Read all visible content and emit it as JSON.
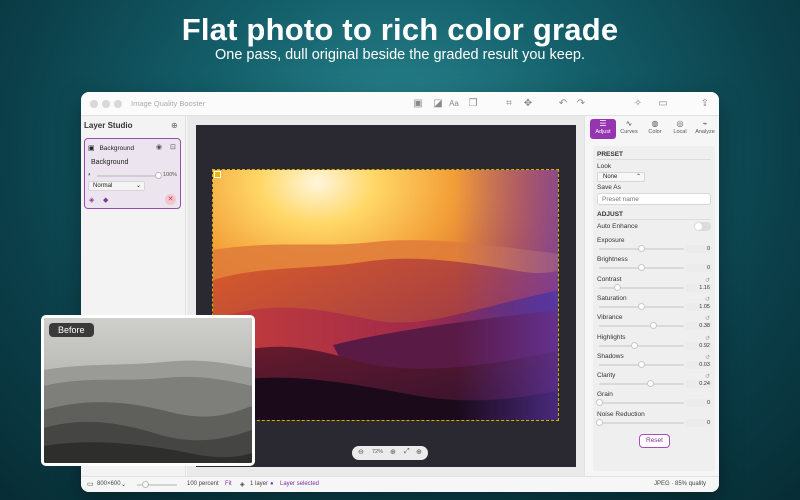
{
  "hero": {
    "title": "Flat photo to rich color grade",
    "subtitle": "One pass, dull original beside the graded result you keep."
  },
  "window": {
    "title": "Image Quality Booster"
  },
  "layers": {
    "header": "Layer Studio",
    "item_name": "Background",
    "rename_value": "Background",
    "opacity": "100%",
    "blend_mode": "Normal"
  },
  "canvas": {
    "zoom": "72%"
  },
  "inspector": {
    "tabs": [
      {
        "label": "Adjust",
        "icon": "sliders-icon"
      },
      {
        "label": "Curves",
        "icon": "curves-icon"
      },
      {
        "label": "Color",
        "icon": "palette-icon"
      },
      {
        "label": "Local",
        "icon": "target-icon"
      },
      {
        "label": "Analyze",
        "icon": "analyze-icon"
      }
    ],
    "preset_header": "PRESET",
    "look_label": "Look",
    "look_value": "None",
    "saveas_label": "Save As",
    "preset_placeholder": "Preset name",
    "adjust_header": "ADJUST",
    "auto_enhance_label": "Auto Enhance",
    "auto_enhance_on": false,
    "sliders": [
      {
        "label": "Exposure",
        "value": "0",
        "level": 0.5
      },
      {
        "label": "Brightness",
        "value": "0",
        "level": 0.5
      },
      {
        "label": "Contrast",
        "value": "1.16",
        "level": 0.22
      },
      {
        "label": "Saturation",
        "value": "1.05",
        "level": 0.5
      },
      {
        "label": "Vibrance",
        "value": "0.38",
        "level": 0.64
      },
      {
        "label": "Highlights",
        "value": "0.92",
        "level": 0.42
      },
      {
        "label": "Shadows",
        "value": "0.03",
        "level": 0.5
      },
      {
        "label": "Clarity",
        "value": "0.24",
        "level": 0.6
      },
      {
        "label": "Grain",
        "value": "0",
        "level": 0.0
      },
      {
        "label": "Noise Reduction",
        "value": "0",
        "level": 0.0
      }
    ],
    "reset_label": "Reset"
  },
  "status": {
    "size": "800×600",
    "zoom_text": "100 percent",
    "fit_label": "Fit",
    "layers_count": "1 layer",
    "selection": "Layer selected",
    "format": "JPEG · 85% quality"
  },
  "before": {
    "label": "Before"
  },
  "colors": {
    "accent": "#9536b0",
    "selection_border": "#d4b300"
  }
}
